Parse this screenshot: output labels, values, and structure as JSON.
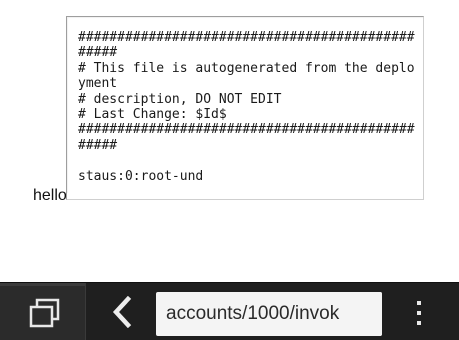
{
  "page": {
    "label_text": "hello",
    "textarea_value": "################################################\n# This file is autogenerated from the deployment\n# description, DO NOT EDIT\n# Last Change: $Id$\n################################################\n\nstaus:0:root-und"
  },
  "toolbar": {
    "address_text": "accounts/1000/invok",
    "tabs_icon": "tabs-icon",
    "back_icon": "back-icon",
    "menu_icon": "overflow-menu-icon"
  },
  "colors": {
    "toolbar_background": "#1f1f1f",
    "address_field_background": "#f4f4f4",
    "icon_color": "#e8e8e8"
  }
}
